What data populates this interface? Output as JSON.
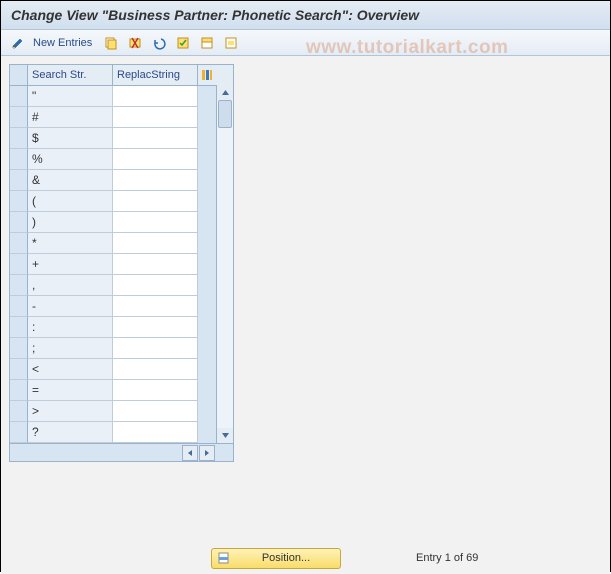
{
  "title": "Change View \"Business Partner: Phonetic Search\": Overview",
  "watermark": "www.tutorialkart.com",
  "toolbar": {
    "new_entries_label": "New Entries"
  },
  "table": {
    "columns": {
      "search": "Search Str.",
      "replace": "ReplacString"
    },
    "rows": [
      {
        "search": "\"",
        "replace": ""
      },
      {
        "search": "#",
        "replace": ""
      },
      {
        "search": "$",
        "replace": ""
      },
      {
        "search": "%",
        "replace": ""
      },
      {
        "search": "&",
        "replace": ""
      },
      {
        "search": "(",
        "replace": ""
      },
      {
        "search": ")",
        "replace": ""
      },
      {
        "search": "*",
        "replace": ""
      },
      {
        "search": "+",
        "replace": ""
      },
      {
        "search": ",",
        "replace": ""
      },
      {
        "search": "-",
        "replace": ""
      },
      {
        "search": ":",
        "replace": ""
      },
      {
        "search": ";",
        "replace": ""
      },
      {
        "search": "<",
        "replace": ""
      },
      {
        "search": "=",
        "replace": ""
      },
      {
        "search": ">",
        "replace": ""
      },
      {
        "search": "?",
        "replace": ""
      }
    ]
  },
  "footer": {
    "position_label": "Position...",
    "entry_text": "Entry 1 of 69"
  }
}
